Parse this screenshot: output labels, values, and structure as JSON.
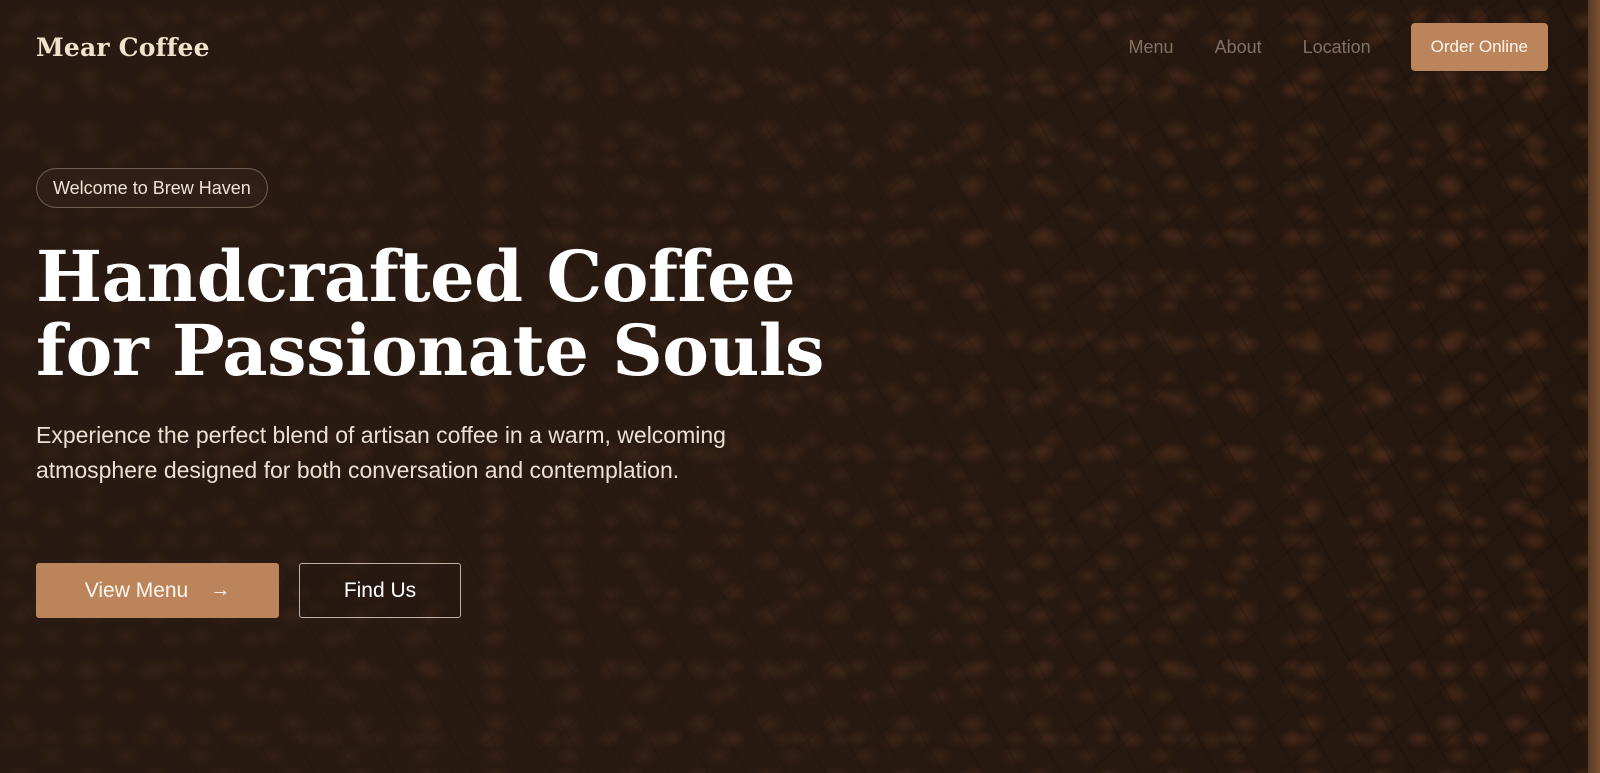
{
  "brand": {
    "name": "Mear Coffee"
  },
  "nav": {
    "links": [
      {
        "label": "Menu"
      },
      {
        "label": "About"
      },
      {
        "label": "Location"
      }
    ],
    "cta_label": "Order Online"
  },
  "hero": {
    "badge": "Welcome to Brew Haven",
    "headline_line1": "Handcrafted Coffee",
    "headline_line2": "for Passionate Souls",
    "description": "Experience the perfect blend of artisan coffee in a warm, welcoming atmosphere designed for both conversation and contemplation.",
    "primary_button": {
      "label": "View Menu",
      "icon": "arrow-right-icon"
    },
    "secondary_button": {
      "label": "Find Us"
    }
  },
  "colors": {
    "accent": "#bc845a",
    "background": "#2a1a10",
    "text": "#ffffff"
  }
}
